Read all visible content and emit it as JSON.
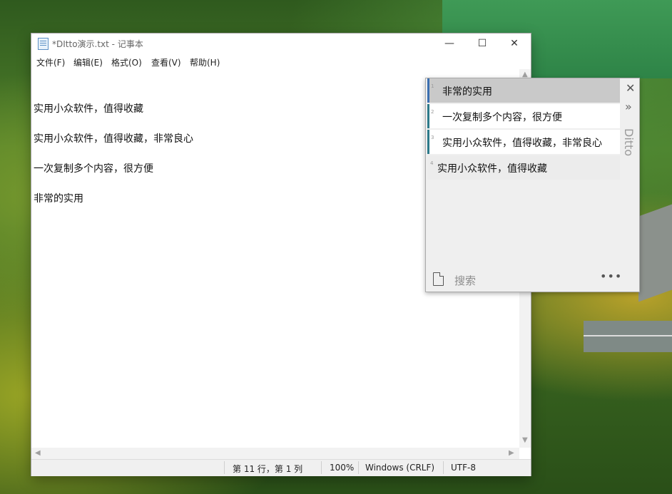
{
  "notepad": {
    "title": "*DItto演示.txt - 记事本",
    "window_controls": {
      "minimize": "—",
      "maximize": "☐",
      "close": "✕"
    },
    "menu": [
      "文件(F)",
      "编辑(E)",
      "格式(O)",
      "查看(V)",
      "帮助(H)"
    ],
    "lines": [
      "实用小众软件，值得收藏",
      "实用小众软件，值得收藏，非常良心",
      "一次复制多个内容，很方便",
      "非常的实用"
    ],
    "status": {
      "position": "第 11 行，第 1 列",
      "zoom": "100%",
      "line_ending": "Windows (CRLF)",
      "encoding": "UTF-8"
    }
  },
  "ditto": {
    "items": [
      {
        "num": "1",
        "text": "非常的实用"
      },
      {
        "num": "2",
        "text": "一次复制多个内容，很方便"
      },
      {
        "num": "3",
        "text": "实用小众软件，值得收藏，非常良心"
      },
      {
        "num": "4",
        "text": "实用小众软件，值得收藏"
      }
    ],
    "close": "✕",
    "expand": "»",
    "brand": "Ditto",
    "search_label": "搜索",
    "more": "•••"
  }
}
